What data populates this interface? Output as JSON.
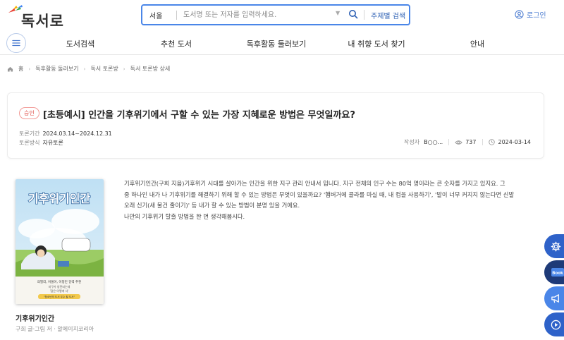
{
  "header": {
    "logo": "독서로",
    "search_region": "서울",
    "search_placeholder": "도서명 또는 저자를 입력하세요.",
    "theme_search": "주제별 검색",
    "login": "로그인"
  },
  "nav": {
    "items": [
      "도서검색",
      "추천 도서",
      "독후활동 둘러보기",
      "내 취향 도서 찾기",
      "안내"
    ]
  },
  "breadcrumb": [
    "홈",
    "독후활동 둘러보기",
    "독서 토론방",
    "독서 토론방 상세"
  ],
  "topic": {
    "status": "승인",
    "title": "[초등예시] 인간을 기후위기에서 구할 수 있는 가장 지혜로운 방법은 무엇일까요?",
    "period_label": "토론기간",
    "period_value": "2024.03.14~2024.12.31",
    "method_label": "토론방식",
    "method_value": "자유토론",
    "author_label": "작성자",
    "author_value": "B○○...",
    "views": "737",
    "date": "2024-03-14"
  },
  "book": {
    "cover_title": "기후위기인간",
    "cover_lines": [
      "의필리, 어울어, 이정민 강력 추천",
      "지구가 방전되는데",
      "'갑은 어떻게 사'",
      "\"청소년의 도서 우수 필 도서\""
    ],
    "title": "기후위기인간",
    "author": "구희 글·그림 저 · 알에이치코리아"
  },
  "description": [
    "기후위기인간(구희 지음)기후위기 시대를 살아가는 인간을 위한 지구 관리 안내서 입니다. 지구 전체의 인구 수는 80억 명이라는 큰 숫자를 가지고 있지요. 그",
    "중 하나인 내가 나 기후위기를 해결하기 위해 할 수 있는 방법은 무엇이 있을까요? '햄버거에 콜라를 마실 때, 내 컵을 사용하기', '발이 너무 커지지 않는다면 신발",
    "오래 신기(새 물건 줄이기)' 등 내가 할 수 있는 방법이 분명 있을 거에요.",
    "나만의 기후위기 탈출 방법을 한 번 생각해봅시다."
  ],
  "fabs": [
    {
      "icon": "gear-icon",
      "color": "#2e62c9"
    },
    {
      "icon": "book-icon",
      "label": "Book",
      "color": "#1e3a78"
    },
    {
      "icon": "megaphone-icon",
      "color": "#4a86e8"
    },
    {
      "icon": "play-icon",
      "color": "#2e62c9"
    }
  ],
  "colors": {
    "accent": "#4a86e8",
    "badge": "#e0554f"
  }
}
